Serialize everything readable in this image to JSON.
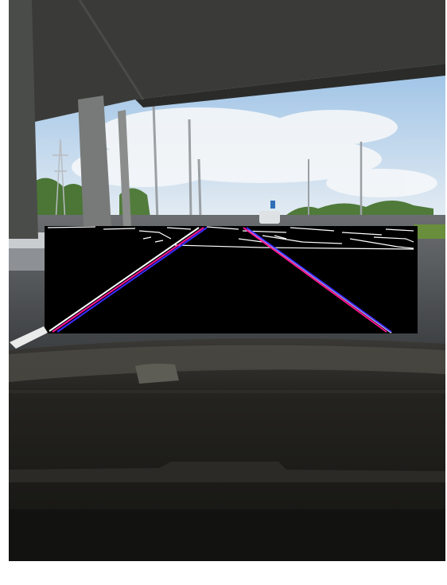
{
  "scene": {
    "description_tags": [
      "dashcam-frame",
      "highway-underpass",
      "lane-detection-overlay"
    ],
    "colors": {
      "sky_top": "#9cc2e6",
      "sky_bottom": "#e8eef4",
      "cloud": "#f4f6f8",
      "overpass": "#3b3c3a",
      "pillar": "#6f7270",
      "trees": "#4f7a3a",
      "road": "#4c4f52",
      "dashboard": "#1e1d1b",
      "mask_bg": "#000000",
      "mask_edges": "#ffffff",
      "lane_line_a": "#ff1493",
      "lane_line_b": "#3b2cff"
    }
  },
  "overlay": {
    "type": "lane-detection-mask",
    "lanes": [
      {
        "name": "left-lane",
        "detected": true
      },
      {
        "name": "right-lane",
        "detected": true
      }
    ]
  }
}
